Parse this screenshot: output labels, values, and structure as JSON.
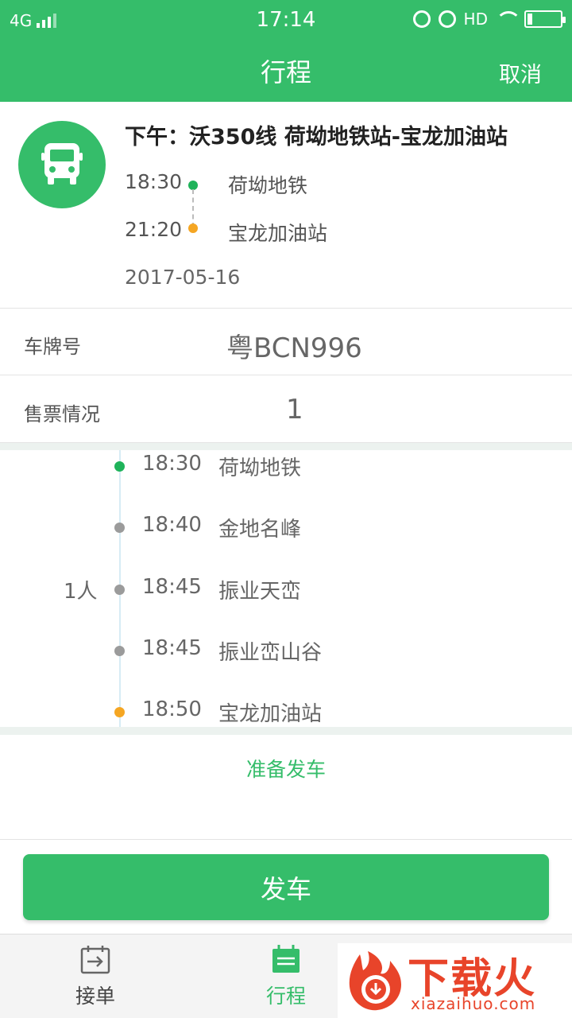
{
  "status_bar": {
    "network": "4G",
    "time": "17:14",
    "hd": "HD"
  },
  "header": {
    "title": "行程",
    "cancel_label": "取消"
  },
  "trip": {
    "title": "下午：沃350线 荷坳地铁站-宝龙加油站",
    "start_time": "18:30",
    "start_place": "荷坳地铁",
    "end_time": "21:20",
    "end_place": "宝龙加油站",
    "date": "2017-05-16",
    "icon": "bus-icon"
  },
  "plate": {
    "label": "车牌号",
    "value": "粤BCN996"
  },
  "tickets": {
    "label": "售票情况",
    "value": "1"
  },
  "stops": [
    {
      "time": "18:30",
      "place": "荷坳地铁",
      "count": "",
      "color": "#1fb35a"
    },
    {
      "time": "18:40",
      "place": "金地名峰",
      "count": "",
      "color": "#9b9b9b"
    },
    {
      "time": "18:45",
      "place": "振业天峦",
      "count": "1人",
      "color": "#9b9b9b"
    },
    {
      "time": "18:45",
      "place": "振业峦山谷",
      "count": "",
      "color": "#9b9b9b"
    },
    {
      "time": "18:50",
      "place": "宝龙加油站",
      "count": "",
      "color": "#f5a623"
    }
  ],
  "ready_label": "准备发车",
  "depart_label": "发车",
  "tabs": [
    {
      "label": "接单",
      "icon": "order-icon",
      "active": false
    },
    {
      "label": "行程",
      "icon": "trip-icon",
      "active": true
    }
  ],
  "watermark": {
    "cn": "下载火",
    "en": "xiazaihuo.com"
  },
  "colors": {
    "primary": "#35bd6a",
    "start_dot": "#1fb35a",
    "end_dot": "#f5a623"
  }
}
